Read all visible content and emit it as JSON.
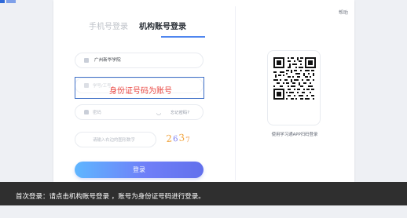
{
  "corner_link": "帮助",
  "tabs": {
    "phone_login": "手机号登录",
    "org_account_login": "机构账号登录"
  },
  "form": {
    "school": "广州新华学院",
    "id_placeholder": "学号/工号",
    "password_placeholder": "密码",
    "forgot_password": "忘记密码?",
    "captcha_placeholder": "请输入右边的图形数字",
    "captcha_value": "2637",
    "login_button": "登录"
  },
  "qr": {
    "caption": "使用学习通APP扫码登录"
  },
  "annotation": {
    "text": "身份证号码为账号"
  },
  "banner": {
    "text": "首次登录：请点击机构账号登录 ，账号为身份证号码进行登录。"
  },
  "icons": {
    "school": "building-icon",
    "id": "id-card-icon",
    "password": "lock-icon",
    "eye": "eye-icon",
    "qr": "qr-code-icon"
  },
  "colors": {
    "accent": "#4f86ef",
    "annotation_red": "#e9443f",
    "annotation_blue": "#3e6fc7",
    "banner_bg": "#2f2f2f"
  }
}
